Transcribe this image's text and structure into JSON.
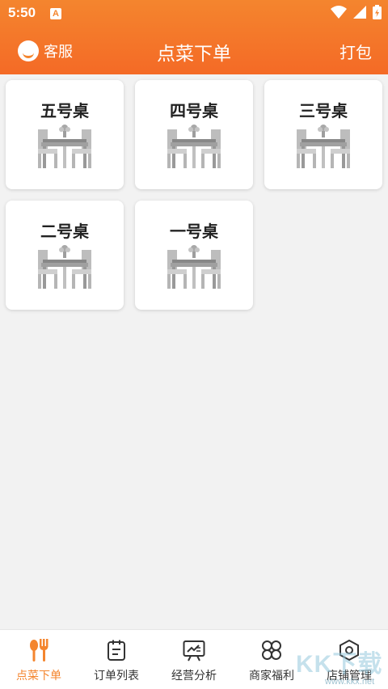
{
  "status_bar": {
    "time": "5:50",
    "app_badge": "A"
  },
  "header": {
    "title": "点菜下单",
    "customer_service_label": "客服",
    "pack_label": "打包"
  },
  "tables": [
    {
      "label": "五号桌"
    },
    {
      "label": "四号桌"
    },
    {
      "label": "三号桌"
    },
    {
      "label": "二号桌"
    },
    {
      "label": "一号桌"
    }
  ],
  "tabbar": {
    "items": [
      {
        "label": "点菜下单",
        "active": true,
        "icon": "utensils-icon"
      },
      {
        "label": "订单列表",
        "active": false,
        "icon": "order-list-icon"
      },
      {
        "label": "经营分析",
        "active": false,
        "icon": "chart-board-icon"
      },
      {
        "label": "商家福利",
        "active": false,
        "icon": "clover-icon"
      },
      {
        "label": "店铺管理",
        "active": false,
        "icon": "store-settings-icon"
      }
    ]
  },
  "watermark": {
    "text": "KK下载",
    "url": "www.kkx.net"
  },
  "colors": {
    "accent": "#f4852e",
    "header_start": "#f4852e",
    "header_end": "#f46a26",
    "background": "#f2f2f2"
  }
}
